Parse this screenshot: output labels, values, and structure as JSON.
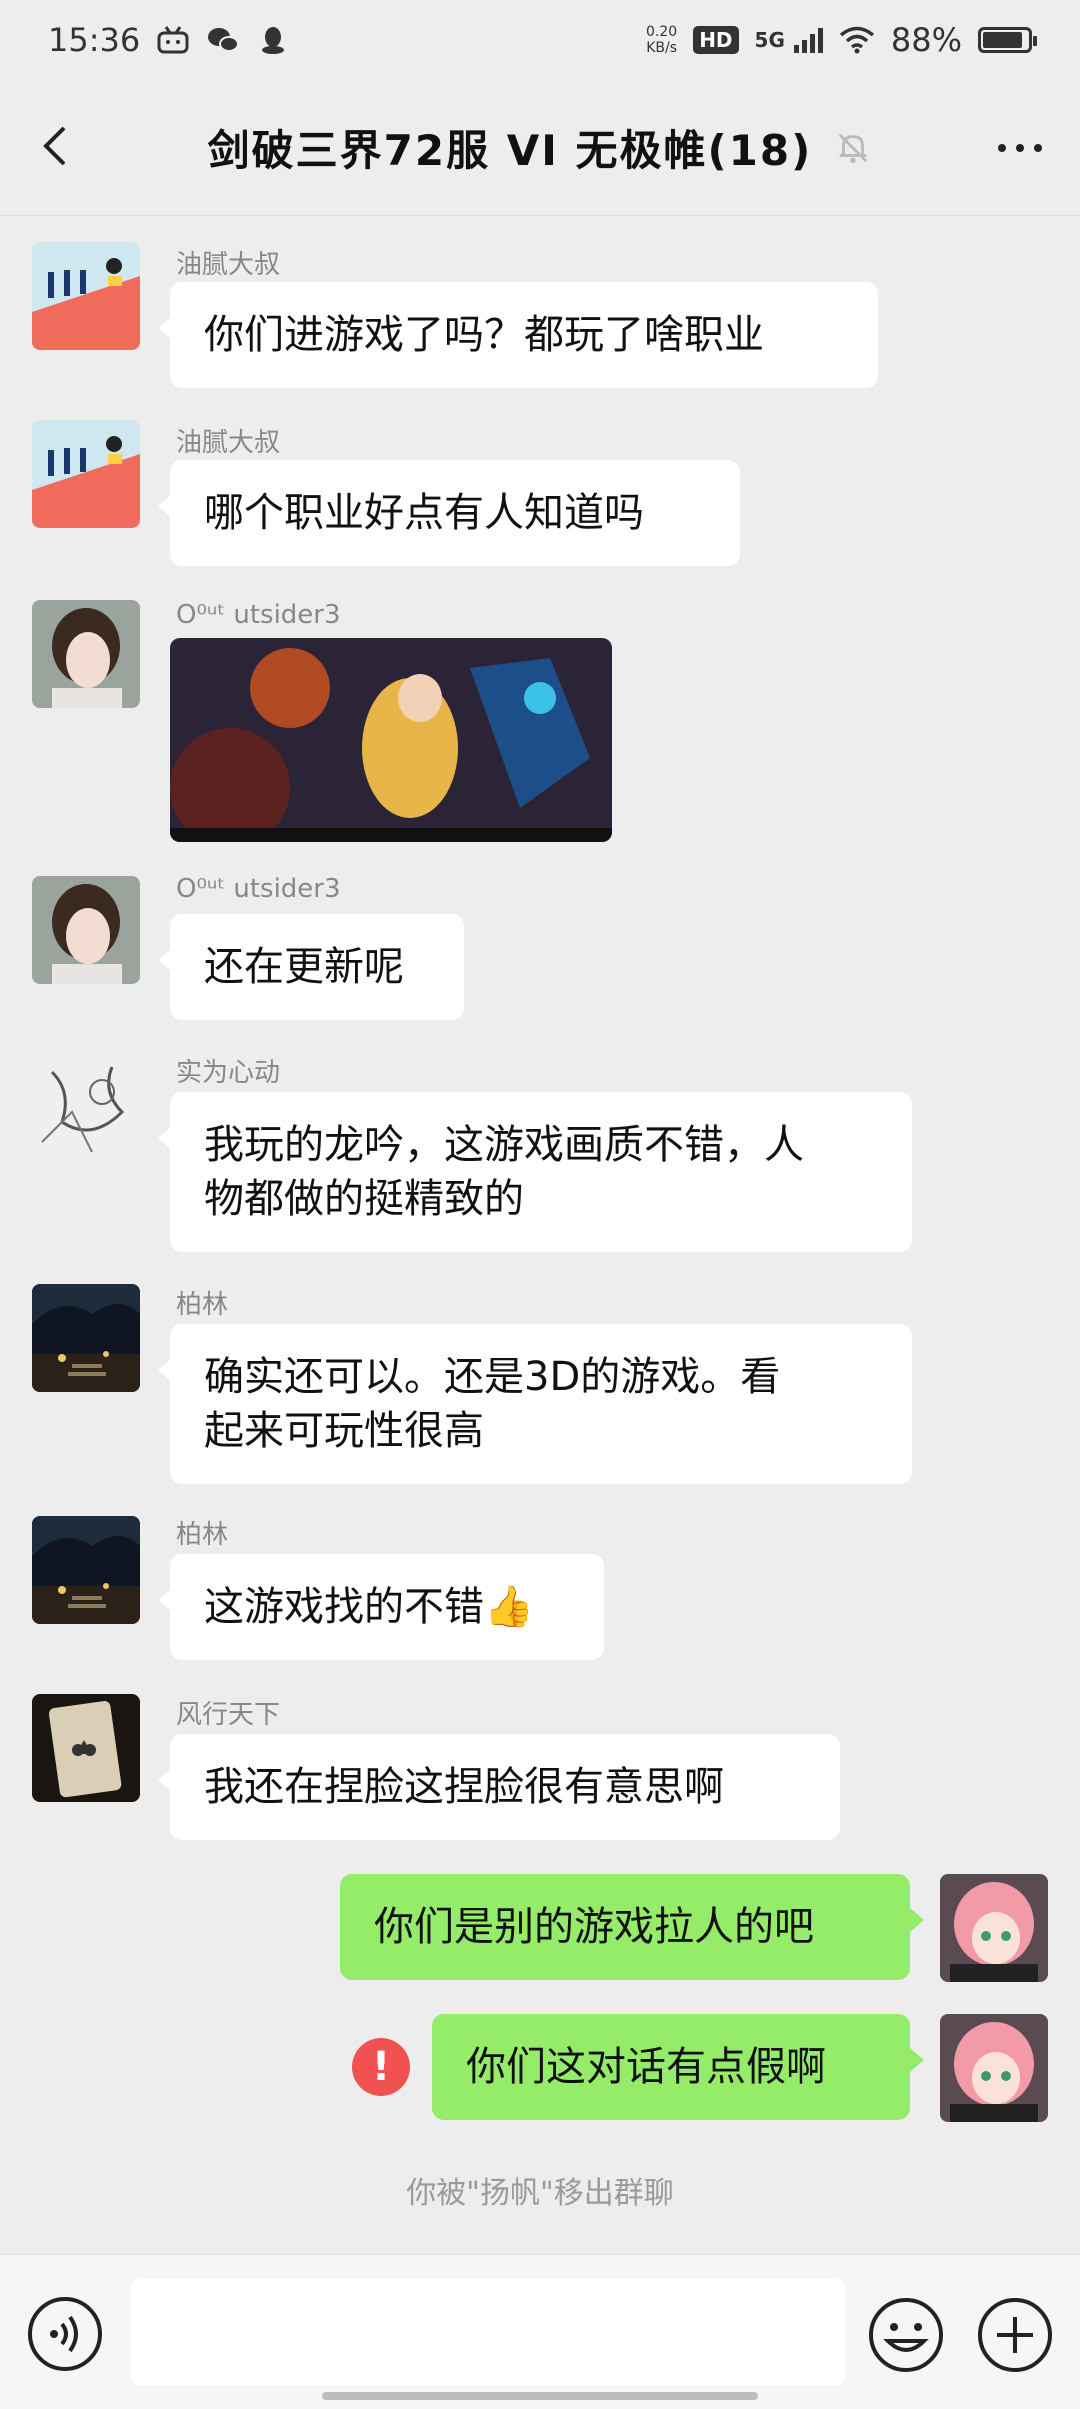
{
  "status_bar": {
    "time": "15:36",
    "net_speed_value": "0.20",
    "net_speed_unit": "KB/s",
    "hd_label": "HD",
    "network": "5G",
    "battery_text": "88%",
    "battery_level": 0.88,
    "left_icons": [
      "bilibili-icon",
      "wechat-icon",
      "qq-icon"
    ]
  },
  "header": {
    "title": "剑破三界72服 VI 无极帷(18)",
    "back_icon": "chevron-left-icon",
    "mute_icon": "bell-off-icon",
    "more_icon": "more-dots-icon"
  },
  "messages": [
    {
      "id": 1,
      "sender": "油腻大叔",
      "text": "你们进游戏了吗？都玩了啥职业",
      "avatar_icon": "avatar-landscape"
    },
    {
      "id": 2,
      "sender": "油腻大叔",
      "text": "哪个职业好点有人知道吗",
      "avatar_icon": "avatar-landscape"
    },
    {
      "id": 3,
      "sender": "O⁰ᵘᵗ utsider3",
      "type": "image",
      "avatar_icon": "avatar-girl"
    },
    {
      "id": 4,
      "sender": "O⁰ᵘᵗ utsider3",
      "text": "还在更新呢",
      "avatar_icon": "avatar-girl"
    },
    {
      "id": 5,
      "sender": "实为心动",
      "text_line1": "我玩的龙吟，这游戏画质不错，人",
      "text_line2": "物都做的挺精致的",
      "avatar_icon": "avatar-sketch"
    },
    {
      "id": 6,
      "sender": "柏林",
      "text_line1": "确实还可以。还是3D的游戏。看",
      "text_line2": "起来可玩性很高",
      "avatar_icon": "avatar-night"
    },
    {
      "id": 7,
      "sender": "柏林",
      "text": "这游戏找的不错",
      "emoji": "👍",
      "avatar_icon": "avatar-night"
    },
    {
      "id": 8,
      "sender": "风行天下",
      "text": "我还在捏脸这捏脸很有意思啊",
      "avatar_icon": "avatar-card"
    },
    {
      "id": 9,
      "sender": "me",
      "text": "你们是别的游戏拉人的吧",
      "avatar_icon": "avatar-anime"
    },
    {
      "id": 10,
      "sender": "me",
      "text": "你们这对话有点假啊",
      "failed": true,
      "error_mark": "!",
      "avatar_icon": "avatar-anime"
    }
  ],
  "system_note": "你被\"扬帆\"移出群聊",
  "input_bar": {
    "voice_icon": "voice-icon",
    "emoji_icon": "emoji-icon",
    "plus_icon": "plus-icon",
    "input_value": ""
  },
  "colors": {
    "background": "#ededed",
    "sent_bubble": "#95ec69",
    "received_bubble": "#ffffff",
    "error": "#f25151"
  }
}
